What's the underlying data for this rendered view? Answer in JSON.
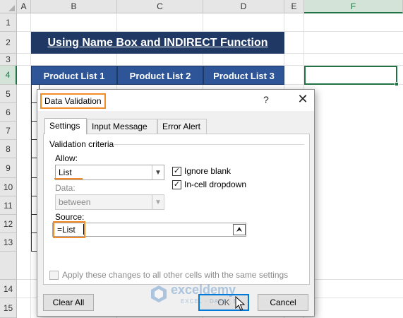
{
  "sheet": {
    "columns": [
      "A",
      "B",
      "C",
      "D",
      "E",
      "F"
    ],
    "selected_column": "F",
    "rows": [
      "1",
      "2",
      "3",
      "4",
      "5",
      "6",
      "7",
      "8",
      "9",
      "10",
      "11",
      "12",
      "13",
      "14",
      "15"
    ],
    "selected_row": "4",
    "title": "Using Name Box and INDIRECT Function",
    "table_headers": [
      "Product List 1",
      "Product List 2",
      "Product List 3"
    ]
  },
  "dialog": {
    "title": "Data Validation",
    "help": "?",
    "close": "✕",
    "tabs": [
      "Settings",
      "Input Message",
      "Error Alert"
    ],
    "active_tab": "Settings",
    "section": "Validation criteria",
    "allow_label": "Allow:",
    "allow_value": "List",
    "data_label": "Data:",
    "data_value": "between",
    "ignore_blank": {
      "label": "Ignore blank",
      "checked": true
    },
    "in_cell_dropdown": {
      "label": "In-cell dropdown",
      "checked": true
    },
    "source_label": "Source:",
    "source_value": "=List",
    "apply_all": {
      "label": "Apply these changes to all other cells with the same settings",
      "checked": false
    },
    "buttons": {
      "clear_all": "Clear All",
      "ok": "OK",
      "cancel": "Cancel"
    }
  },
  "watermark": {
    "title": "exceldemy",
    "subtitle": "EXCEL · DATA · BI"
  },
  "colors": {
    "title_bg": "#1f3864",
    "header_bg": "#2e5597",
    "highlight": "#f28c28",
    "excel_green": "#217346"
  },
  "icons": {
    "dropdown": "chevron-down-icon",
    "collapse": "collapse-dialog-icon",
    "check": "checkmark-icon",
    "cursor": "mouse-pointer-icon"
  }
}
